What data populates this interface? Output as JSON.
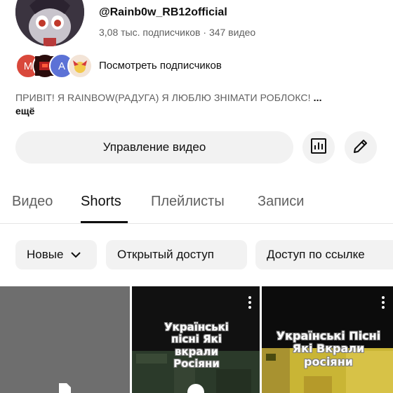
{
  "channel": {
    "handle": "@Rainb0w_RB12official",
    "subscribers": "3,08 тыс. подписчиков",
    "separator": "·",
    "videos": "347 видео",
    "subscriber_avatar_letters": [
      "M",
      "A"
    ],
    "see_subscribers": "Посмотреть подписчиков",
    "description": "ПРИВІТ! Я RAINBOW(РАДУГА) Я ЛЮБЛЮ ЗНІМАТИ РОБЛОКС!",
    "description_ellipsis": "...",
    "more": "ещё"
  },
  "actions": {
    "manage_videos": "Управление видео",
    "stats_icon": "bar-chart-icon",
    "edit_icon": "pencil-icon"
  },
  "tabs": [
    {
      "label": "Видео"
    },
    {
      "label": "Shorts",
      "active": true
    },
    {
      "label": "Плейлисты"
    },
    {
      "label": "Записи"
    }
  ],
  "filters": {
    "sort": "Новые",
    "public": "Открытый доступ",
    "link": "Доступ по ссылке"
  },
  "shorts": [
    {
      "overlay": ""
    },
    {
      "overlay": "Українські пісні Які вкрали Росіяни"
    },
    {
      "overlay": "Українські Пісні Які Вкрали росіяни"
    }
  ],
  "colors": {
    "text_primary": "#0f0f0f",
    "text_secondary": "#606060",
    "chip_bg": "#f2f2f2"
  }
}
